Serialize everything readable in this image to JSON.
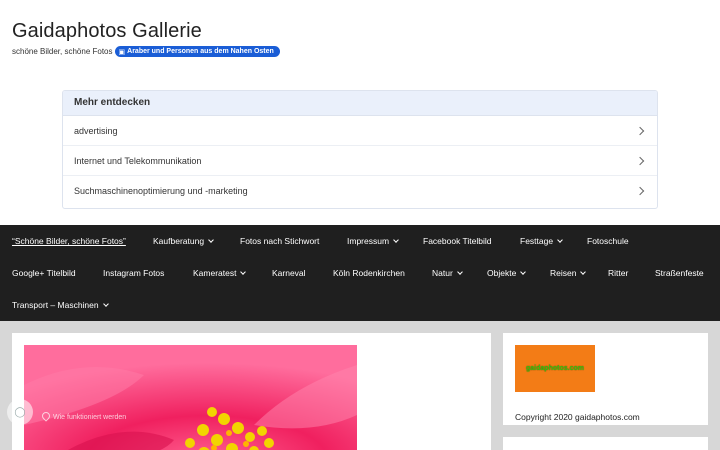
{
  "header": {
    "site_title": "Gaidaphotos Gallerie",
    "tagline": "schöne Bilder, schöne Fotos",
    "tag_chip": {
      "icon": "image-icon",
      "label": "Araber und Personen aus dem Nahen Osten",
      "color": "#1a5dd6"
    }
  },
  "discover": {
    "title": "Mehr entdecken",
    "items": [
      {
        "label": "advertising"
      },
      {
        "label": "Internet und Telekommunikation"
      },
      {
        "label": "Suchmaschinenoptimierung und -marketing"
      }
    ]
  },
  "nav": {
    "row1": [
      {
        "label": "“Schöne Bilder, schöne Fotos”",
        "active": true,
        "dropdown": false
      },
      {
        "label": "Kaufberatung",
        "dropdown": true
      },
      {
        "label": "Fotos nach Stichwort",
        "dropdown": false
      },
      {
        "label": "Impressum",
        "dropdown": true
      },
      {
        "label": "Facebook Titelbild",
        "dropdown": false
      },
      {
        "label": "Festtage",
        "dropdown": true
      },
      {
        "label": "Fotoschule",
        "dropdown": false
      }
    ],
    "row2": [
      {
        "label": "Google+ Titelbild",
        "dropdown": false
      },
      {
        "label": "Instagram Fotos",
        "dropdown": false
      },
      {
        "label": "Kameratest",
        "dropdown": true
      },
      {
        "label": "Karneval",
        "dropdown": false
      },
      {
        "label": "Köln Rodenkirchen",
        "dropdown": false
      },
      {
        "label": "Natur",
        "dropdown": true
      },
      {
        "label": "Objekte",
        "dropdown": true
      },
      {
        "label": "Reisen",
        "dropdown": true
      },
      {
        "label": "Ritter",
        "dropdown": false
      },
      {
        "label": "Straßenfeste",
        "dropdown": false
      }
    ],
    "row3": [
      {
        "label": "Transport – Maschinen",
        "dropdown": true
      }
    ]
  },
  "sidebar": {
    "logo_text": "gaidaphotos.com",
    "copyright": "Copyright 2020 gaidaphotos.com"
  },
  "overlay": {
    "toast_text": "Wie funktioniert werden",
    "badge_icon": "shield-icon"
  },
  "colors": {
    "nav_bg": "#1f1f1f",
    "content_bg": "#d7d7d7",
    "logo_bg": "#f37c16",
    "logo_text": "#3ec20d",
    "photo_pink": "#e8185f"
  }
}
